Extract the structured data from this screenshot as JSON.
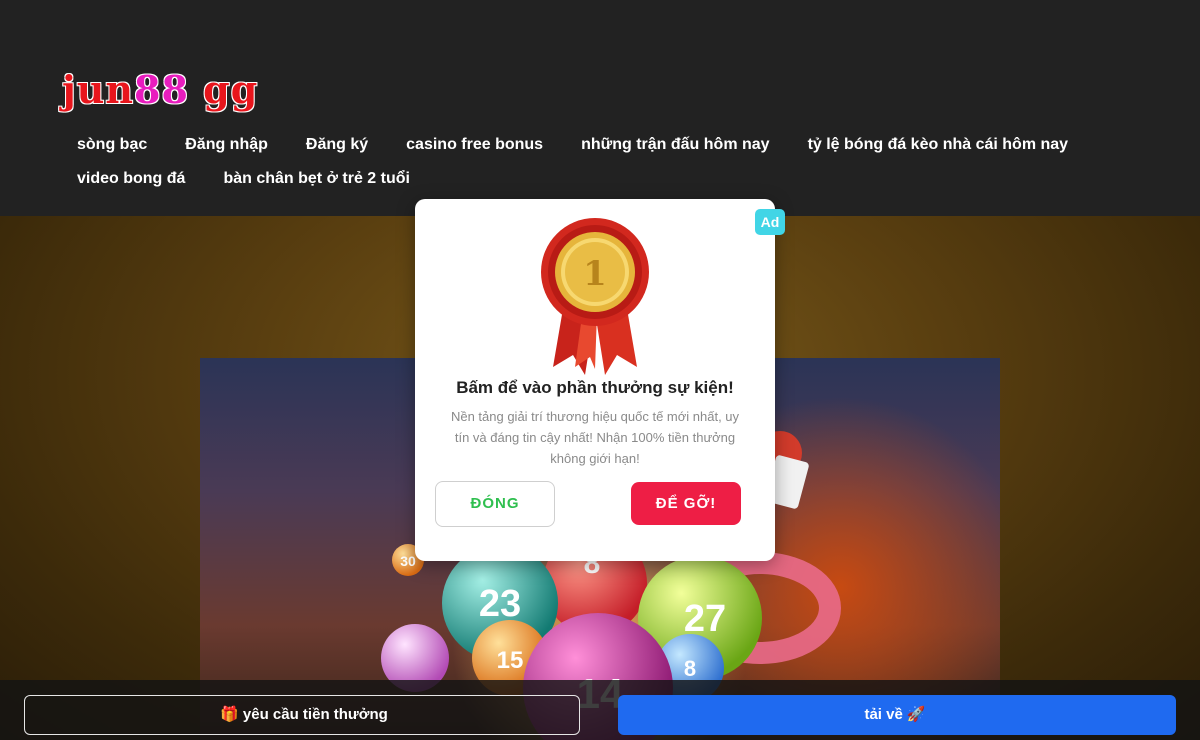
{
  "header": {
    "logo": {
      "part1": "jun",
      "part2": "88",
      "part3": " gg"
    },
    "nav": [
      "sòng bạc",
      "Đăng nhập",
      "Đăng ký",
      "casino free bonus",
      "những trận đấu hôm nay",
      "tỷ lệ bóng đá kèo nhà cái hôm nay",
      "video bong đá",
      "bàn chân bẹt ở trẻ 2 tuổi"
    ]
  },
  "modal": {
    "ad_badge": "Ad",
    "medal_number": "1",
    "title": "Bấm để vào phần thưởng sự kiện!",
    "description": "Nền tảng giải trí thương hiệu quốc tế mới nhất, uy tín và đáng tin cậy nhất! Nhận 100% tiền thưởng không giới hạn!",
    "close_label": "ĐÓNG",
    "go_label": "ĐỂ GỠ!"
  },
  "bottom_bar": {
    "bonus_label": "yêu cầu tiền thưởng",
    "bonus_icon": "gift-icon",
    "download_label": "tải về",
    "download_icon": "rocket-icon"
  },
  "colors": {
    "header_bg": "#222222",
    "ad_badge": "#41d5e6",
    "close_text": "#2fbf4f",
    "go_button": "#ee1e45",
    "download_button": "#1f6af0"
  }
}
